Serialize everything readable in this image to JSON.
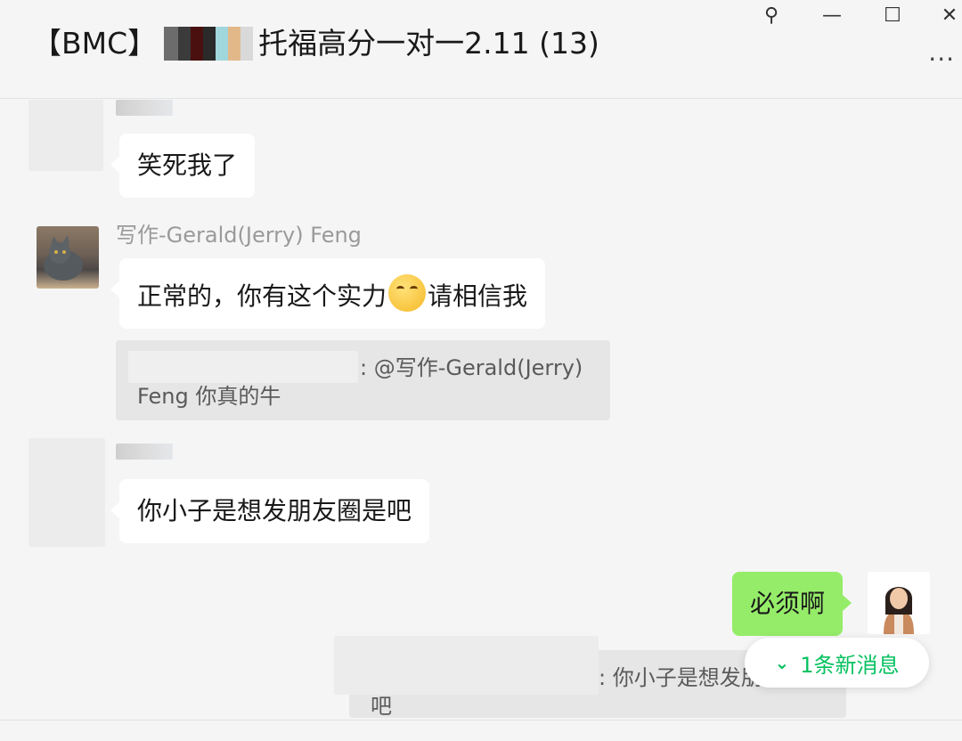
{
  "window": {
    "title_prefix": "【BMC】",
    "title_suffix": "托福高分一对一2.11 (13)",
    "pin_glyph": "⚲",
    "minimize_glyph": "—",
    "maximize_glyph": "☐",
    "close_glyph": "✕",
    "more_glyph": "···"
  },
  "messages": {
    "m1_text": "笑死我了",
    "m2_sender": "写作-Gerald(Jerry) Feng",
    "m2_text_a": "正常的，你有这个实力",
    "m2_text_b": "请相信我",
    "m2_emoji_icon": "thinking-face-icon",
    "quote1_line1": ": @写作-Gerald(Jerry)",
    "quote1_line2": "Feng 你真的牛",
    "m3_text": "你小子是想发朋友圈是吧",
    "m4_text": "必须啊",
    "quote2_line1": ": 你小子是想发朋",
    "quote2_line2": "吧"
  },
  "new_message_button": {
    "icon": "double-chevron-down-icon",
    "label": "1条新消息"
  },
  "colors": {
    "background": "#f5f5f5",
    "bubble_other": "#ffffff",
    "bubble_self": "#95ec69",
    "accent_green": "#07c160",
    "quote_bg": "#e6e6e6"
  }
}
